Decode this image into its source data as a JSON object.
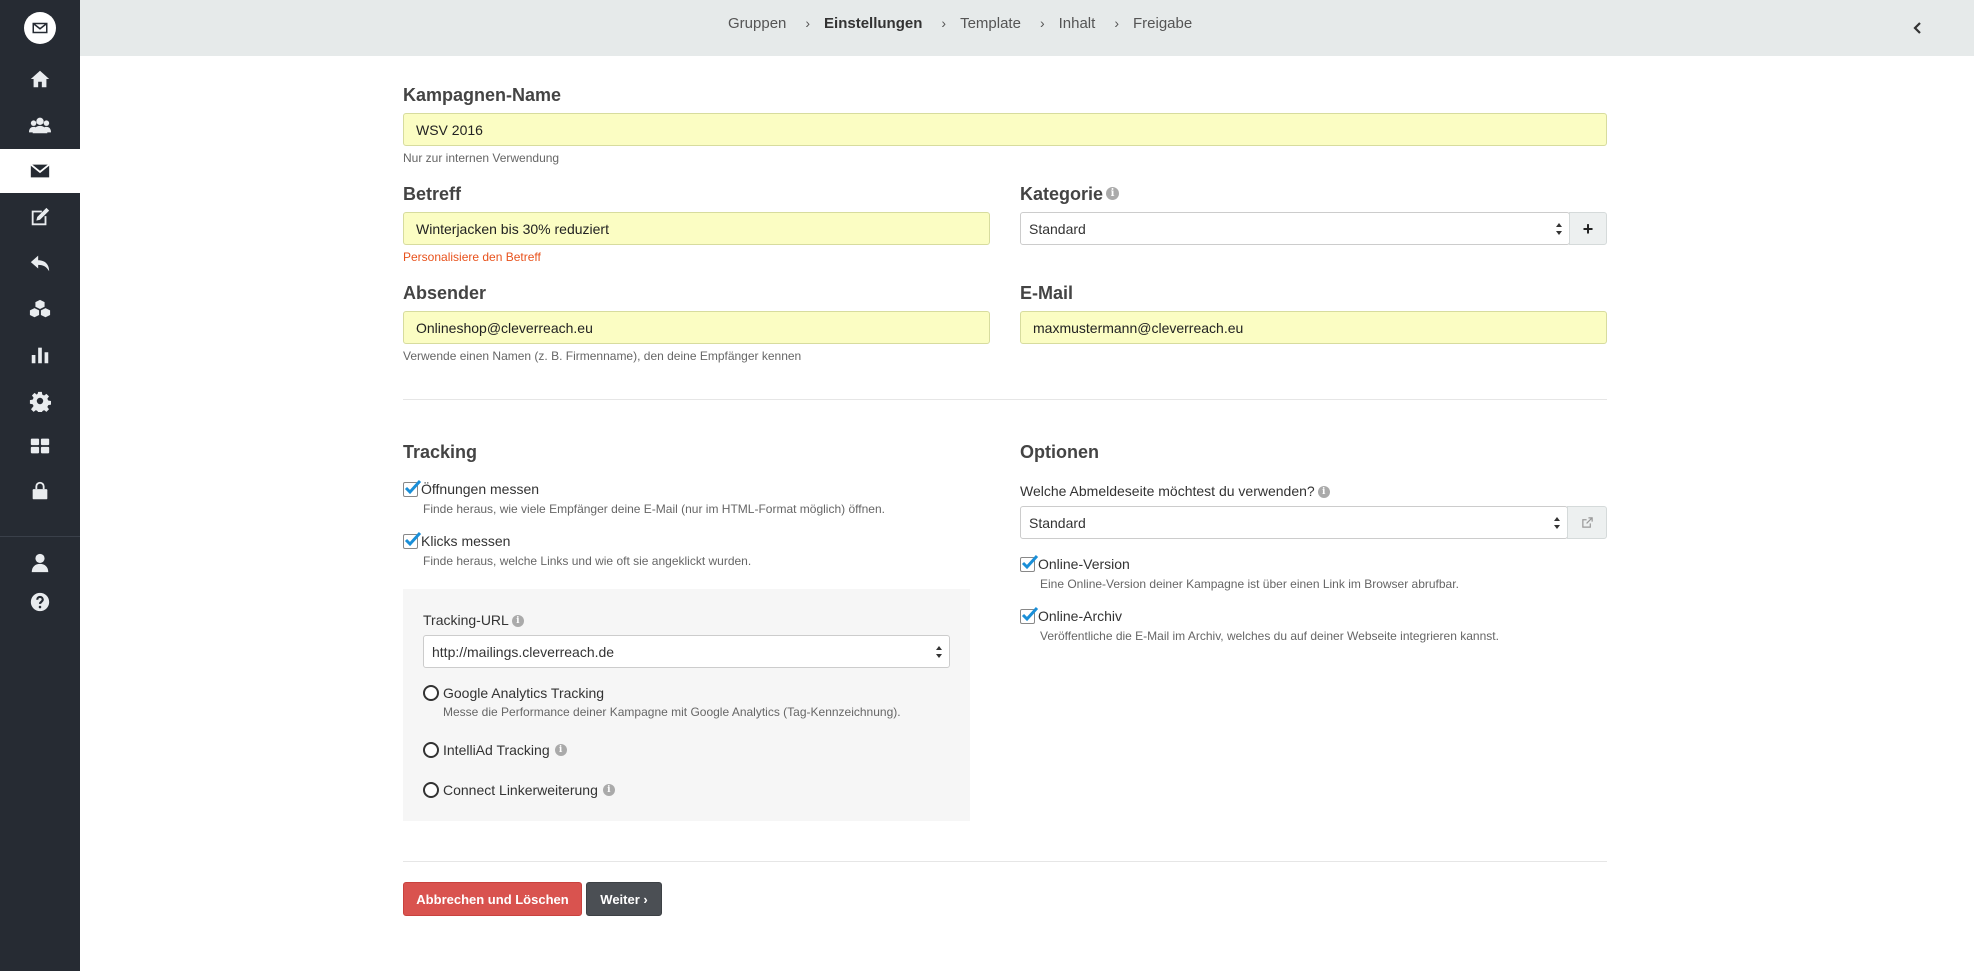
{
  "sidebar": {
    "items": [
      {
        "icon": "home-icon"
      },
      {
        "icon": "users-icon"
      },
      {
        "icon": "envelope-icon",
        "active": true
      },
      {
        "icon": "edit-icon"
      },
      {
        "icon": "reply-icon"
      },
      {
        "icon": "cubes-icon"
      },
      {
        "icon": "bar-chart-icon"
      },
      {
        "icon": "gear-icon"
      },
      {
        "icon": "grid-icon"
      },
      {
        "icon": "lock-icon"
      },
      {
        "icon": "user-icon"
      },
      {
        "icon": "help-icon"
      }
    ]
  },
  "breadcrumb": {
    "items": [
      "Gruppen",
      "Einstellungen",
      "Template",
      "Inhalt",
      "Freigabe"
    ],
    "current": "Einstellungen",
    "separator": "›"
  },
  "form": {
    "campaign_name": {
      "label": "Kampagnen-Name",
      "value": "WSV 2016",
      "help": "Nur zur internen Verwendung"
    },
    "subject": {
      "label": "Betreff",
      "value": "Winterjacken bis 30% reduziert",
      "help": "Personalisiere den Betreff"
    },
    "category": {
      "label": "Kategorie",
      "value": "Standard",
      "add_label": "+"
    },
    "sender": {
      "label": "Absender",
      "value": "Onlineshop@cleverreach.eu",
      "help": "Verwende einen Namen (z. B. Firmenname), den deine Empfänger kennen"
    },
    "email": {
      "label": "E-Mail",
      "value": "maxmustermann@cleverreach.eu"
    }
  },
  "tracking": {
    "title": "Tracking",
    "opens": {
      "label": "Öffnungen messen",
      "desc": "Finde heraus, wie viele Empfänger deine E-Mail (nur im HTML-Format möglich) öffnen.",
      "checked": true
    },
    "clicks": {
      "label": "Klicks messen",
      "desc": "Finde heraus, welche Links und wie oft sie angeklickt wurden.",
      "checked": true
    },
    "url_label": "Tracking-URL",
    "url_value": "http://mailings.cleverreach.de",
    "google": {
      "label": "Google Analytics Tracking",
      "desc": "Messe die Performance deiner Kampagne mit Google Analytics (Tag-Kennzeichnung)."
    },
    "intelliad": {
      "label": "IntelliAd Tracking"
    },
    "connect": {
      "label": "Connect Linkerweiterung"
    }
  },
  "options": {
    "title": "Optionen",
    "unsubscribe_label": "Welche Abmeldeseite möchtest du verwenden?",
    "unsubscribe_value": "Standard",
    "online_version": {
      "label": "Online-Version",
      "desc": "Eine Online-Version deiner Kampagne ist über einen Link im Browser abrufbar.",
      "checked": true
    },
    "online_archive": {
      "label": "Online-Archiv",
      "desc": "Veröffentliche die E-Mail im Archiv, welches du auf deiner Webseite integrieren kannst.",
      "checked": true
    }
  },
  "actions": {
    "cancel": "Abbrechen und Löschen",
    "next": "Weiter ›"
  },
  "colors": {
    "sidebar_bg": "#262b33",
    "topbar_bg": "#e6eaea",
    "input_highlight": "#fbfdc3",
    "danger": "#d9534f",
    "dark_button": "#4b4f54",
    "checkbox_accent": "#1a8fd8",
    "warning_text": "#e8521c"
  }
}
